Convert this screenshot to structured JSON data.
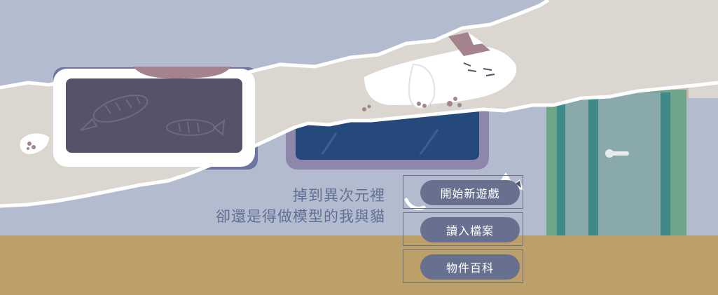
{
  "title": {
    "line1": "掉到異次元裡",
    "line2": "卻還是得做模型的我與貓"
  },
  "menu": {
    "items": [
      {
        "label": "開始新遊戲"
      },
      {
        "label": "讀入檔案"
      },
      {
        "label": "物件百科"
      }
    ]
  },
  "colors": {
    "wall": "#b3bccf",
    "floor": "#bd9f6a",
    "button": "#68708f",
    "title_text": "#5f6f94",
    "door": "#8aa9ab",
    "door_frame": "#6fa68a"
  }
}
